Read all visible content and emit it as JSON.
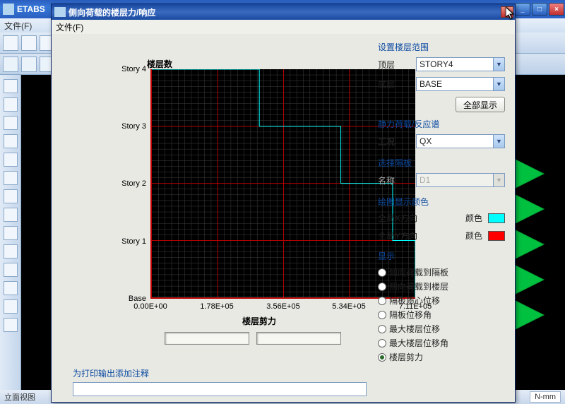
{
  "main_app": {
    "title": "ETABS",
    "menu_file": "文件(F)",
    "status_left": "立面视图",
    "status_right": "N-mm"
  },
  "dialog": {
    "title": "侧向荷载的楼层力/响应",
    "menu_file": "文件(F)",
    "chart_title_y": "楼层数",
    "x_label": "楼层剪力",
    "y_ticks": [
      "Story 4",
      "Story 3",
      "Story 2",
      "Story 1",
      "Base"
    ],
    "x_ticks": [
      "0.00E+00",
      "1.78E+05",
      "3.56E+05",
      "5.34E+05",
      "7.11E+05"
    ],
    "annot_label": "为打印输出添加注释",
    "annot_value": ""
  },
  "right_panel": {
    "group_range": "设置楼层范围",
    "label_top": "顶层",
    "label_bot": "底层",
    "combo_top": "STORY4",
    "combo_bot": "BASE",
    "btn_show_all": "全部显示",
    "group_load": "静力荷载/反应谱",
    "label_case": "工况",
    "combo_case": "QX",
    "group_diaphragm": "选择隔板",
    "label_name": "名称",
    "combo_name": "D1",
    "group_color": "绘图显示颜色",
    "label_gx": "全局X方向",
    "label_gy": "全局Y方向",
    "label_color": "颜色",
    "group_display": "显示",
    "radios": [
      "侧向荷载到隔板",
      "侧向荷载到楼层",
      "隔板质心位移",
      "隔板位移角",
      "最大楼层位移",
      "最大楼层位移角",
      "楼层剪力"
    ],
    "radio_selected_index": 6
  },
  "chart_data": {
    "type": "line",
    "title": "楼层剪力",
    "xlabel": "楼层剪力",
    "ylabel": "楼层数",
    "y_categories": [
      "Story 4",
      "Story 3",
      "Story 2",
      "Story 1",
      "Base"
    ],
    "xlim": [
      0,
      711000
    ],
    "series": [
      {
        "name": "全局X方向",
        "color": "#00ffff",
        "points": [
          {
            "story": "Story 4",
            "value": 290000
          },
          {
            "story": "Story 3",
            "value": 510000
          },
          {
            "story": "Story 2",
            "value": 650000
          },
          {
            "story": "Story 1",
            "value": 711000
          },
          {
            "story": "Base",
            "value": 711000
          }
        ]
      }
    ]
  }
}
